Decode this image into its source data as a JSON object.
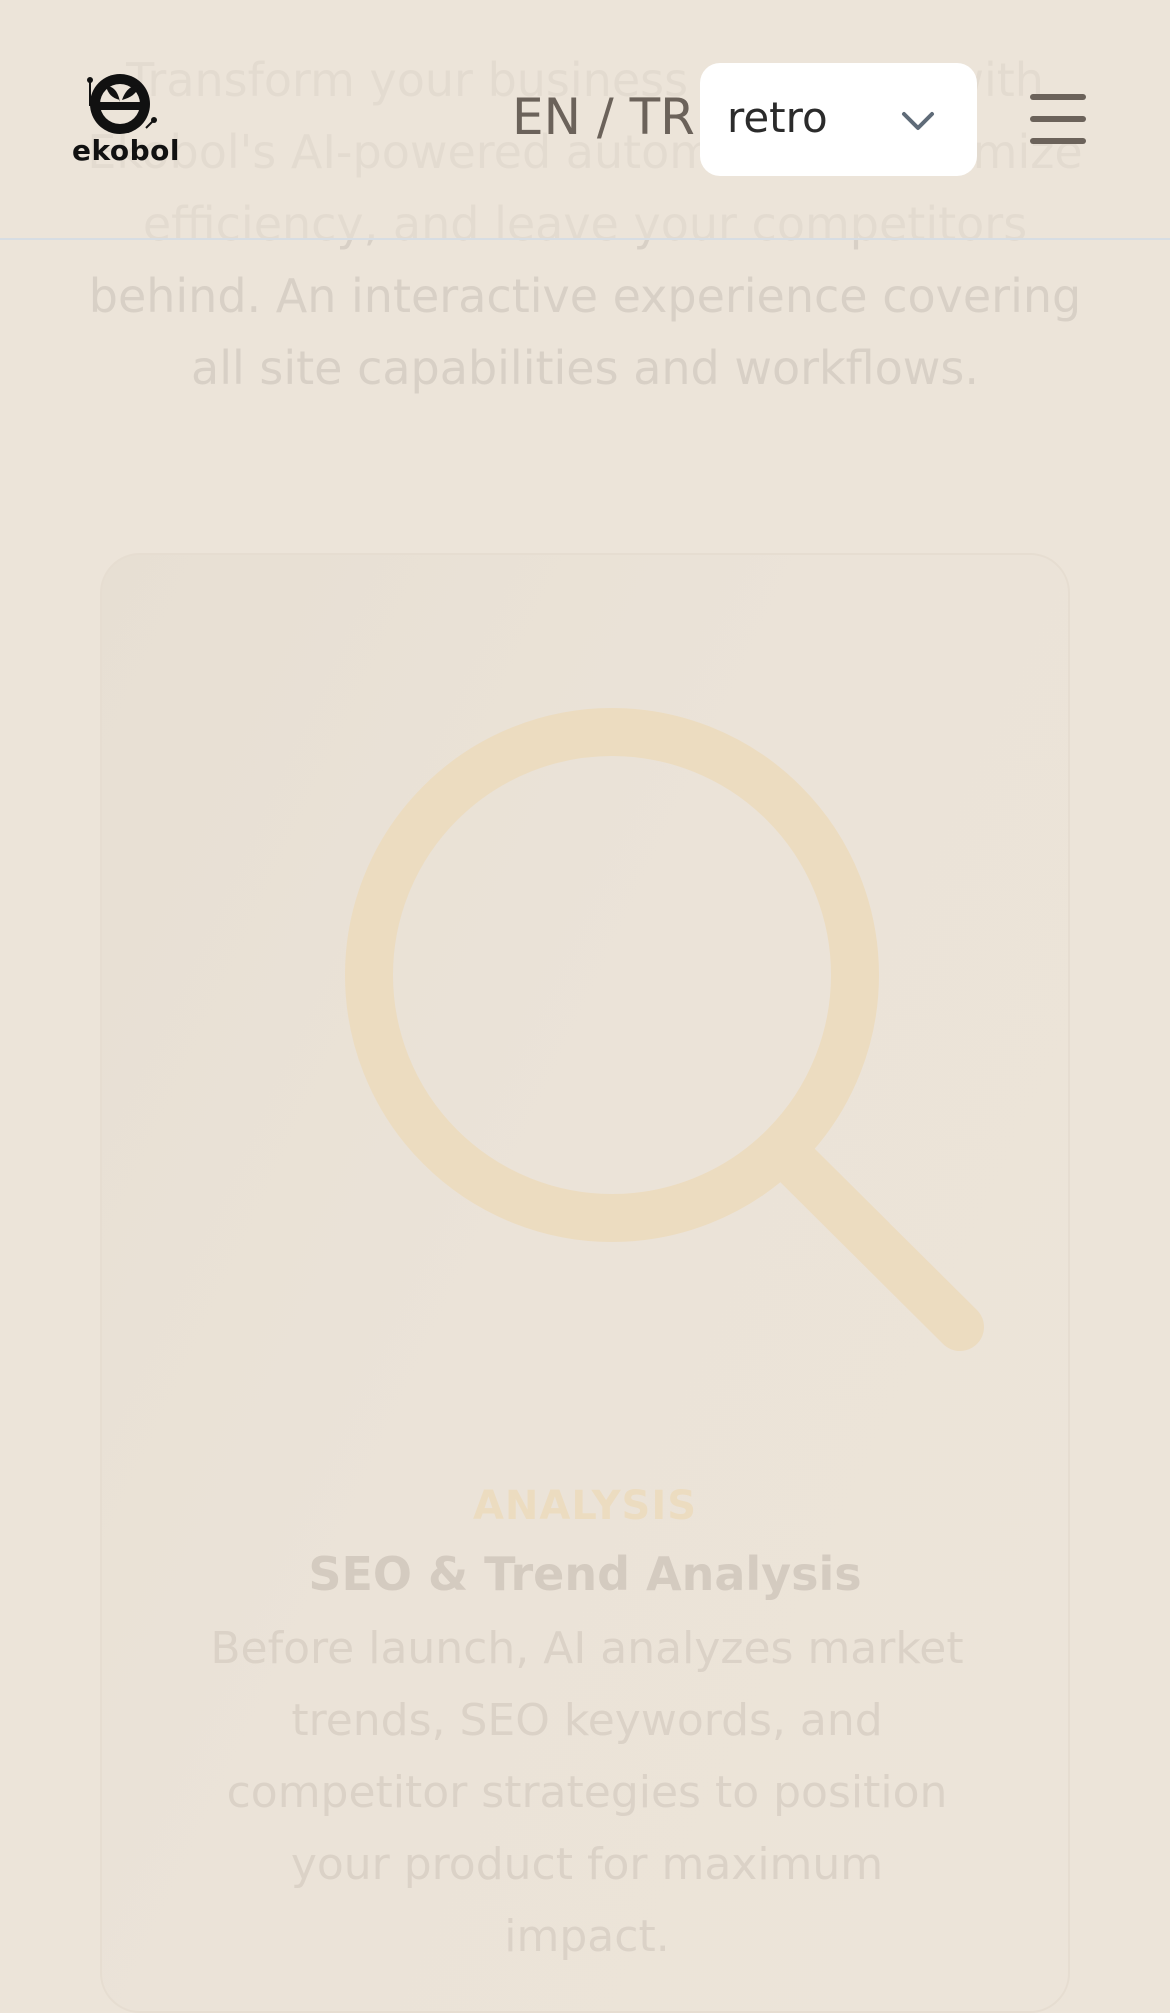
{
  "intro": {
    "text": "Transform your business processes with Ekobol's AI-powered automation, maximize efficiency, and leave your competitors behind. An interactive experience covering all site capabilities and workflows."
  },
  "header": {
    "logo_text": "ekobol",
    "language_toggle": "EN / TR",
    "theme_select": {
      "value": "retro"
    }
  },
  "feature_card": {
    "icon": "search-icon",
    "eyebrow": "ANALYSIS",
    "title": "SEO & Trend Analysis",
    "description": "Before launch, AI analyzes market trends, SEO keywords, and competitor strategies to position your product for maximum impact."
  },
  "colors": {
    "background": "#ece4d9",
    "accent": "#ecdcc0",
    "header_text": "#6b625a"
  }
}
